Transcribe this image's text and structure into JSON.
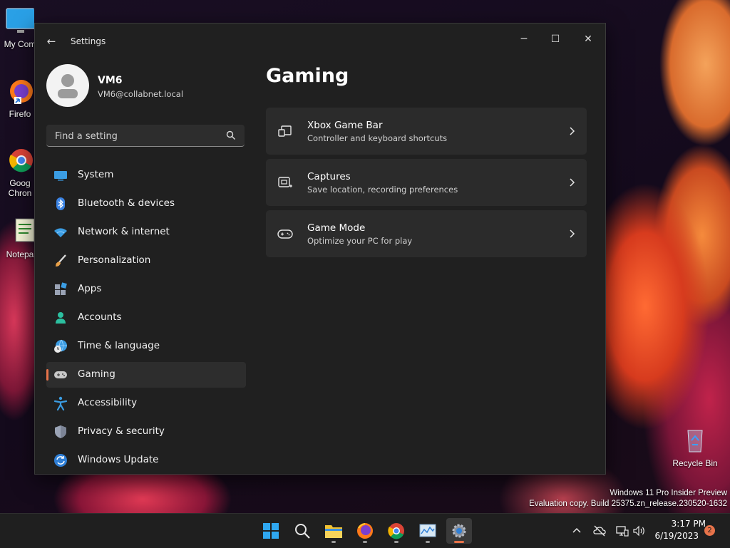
{
  "desktop": {
    "icons": [
      {
        "label": "My Com",
        "icon": "computer-icon"
      },
      {
        "label": "Firefo",
        "icon": "firefox-icon"
      },
      {
        "label": "Goog\nChron",
        "icon": "chrome-icon"
      },
      {
        "label": "Notepa",
        "icon": "notepad-icon"
      },
      {
        "label": "Recycle Bin",
        "icon": "recycle-bin-icon"
      }
    ],
    "watermark_line1": "Windows 11 Pro Insider Preview",
    "watermark_line2": "Evaluation copy. Build 25375.zn_release.230520-1632"
  },
  "window": {
    "title": "Settings",
    "controls": {
      "minimize": "─",
      "maximize": "☐",
      "close": "✕"
    },
    "back_glyph": "←"
  },
  "profile": {
    "name": "VM6",
    "email": "VM6@collabnet.local"
  },
  "search": {
    "placeholder": "Find a setting"
  },
  "nav": {
    "items": [
      {
        "label": "System",
        "icon": "system-icon"
      },
      {
        "label": "Bluetooth & devices",
        "icon": "bluetooth-icon"
      },
      {
        "label": "Network & internet",
        "icon": "wifi-icon"
      },
      {
        "label": "Personalization",
        "icon": "brush-icon"
      },
      {
        "label": "Apps",
        "icon": "apps-icon"
      },
      {
        "label": "Accounts",
        "icon": "accounts-icon"
      },
      {
        "label": "Time & language",
        "icon": "globe-clock-icon"
      },
      {
        "label": "Gaming",
        "icon": "gamepad-icon",
        "active": true
      },
      {
        "label": "Accessibility",
        "icon": "accessibility-icon"
      },
      {
        "label": "Privacy & security",
        "icon": "shield-icon"
      },
      {
        "label": "Windows Update",
        "icon": "update-icon"
      }
    ]
  },
  "main": {
    "title": "Gaming",
    "cards": [
      {
        "title": "Xbox Game Bar",
        "subtitle": "Controller and keyboard shortcuts",
        "icon": "game-bar-icon"
      },
      {
        "title": "Captures",
        "subtitle": "Save location, recording preferences",
        "icon": "capture-icon"
      },
      {
        "title": "Game Mode",
        "subtitle": "Optimize your PC for play",
        "icon": "game-mode-icon"
      }
    ]
  },
  "taskbar": {
    "apps": [
      "start-icon",
      "search-icon",
      "file-explorer-icon",
      "firefox-icon",
      "chrome-icon",
      "task-manager-icon",
      "settings-icon"
    ],
    "active_app": "settings-icon",
    "time": "3:17 PM",
    "date": "6/19/2023",
    "notification_count": "2"
  },
  "colors": {
    "accent": "#e8734a",
    "window_bg": "#202020",
    "card_bg": "#2b2b2b"
  }
}
